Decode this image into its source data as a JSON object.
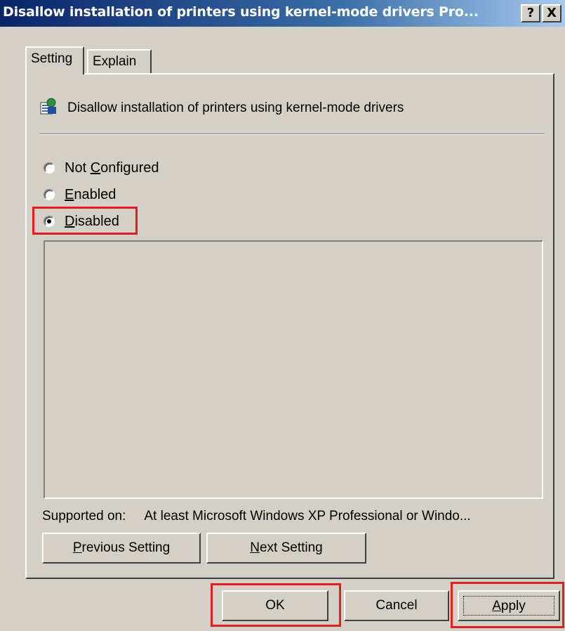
{
  "window": {
    "title": "Disallow installation of printers using kernel-mode drivers Pro...",
    "help_label": "?",
    "close_label": "X"
  },
  "tabs": [
    {
      "label": "Setting",
      "active": true
    },
    {
      "label": "Explain",
      "active": false
    }
  ],
  "policy": {
    "icon": "policy-settings-icon",
    "name": "Disallow installation of printers using kernel-mode drivers"
  },
  "options": {
    "selected": "Disabled",
    "not_configured": {
      "pre": "Not ",
      "accel": "C",
      "post": "onfigured"
    },
    "enabled": {
      "pre": "",
      "accel": "E",
      "post": "nabled"
    },
    "disabled": {
      "pre": "",
      "accel": "D",
      "post": "isabled"
    }
  },
  "supported": {
    "label": "Supported on:",
    "value": "At least Microsoft Windows XP Professional or Windo..."
  },
  "nav_buttons": {
    "previous": {
      "accel": "P",
      "rest": "revious Setting"
    },
    "next": {
      "accel": "N",
      "rest": "ext Setting"
    }
  },
  "footer_buttons": {
    "ok": "OK",
    "cancel": "Cancel",
    "apply": {
      "accel": "A",
      "rest": "pply"
    }
  },
  "colors": {
    "highlight": "#e0201e",
    "dialog_bg": "#d4d0c8",
    "title_bar": "#0a246a"
  }
}
